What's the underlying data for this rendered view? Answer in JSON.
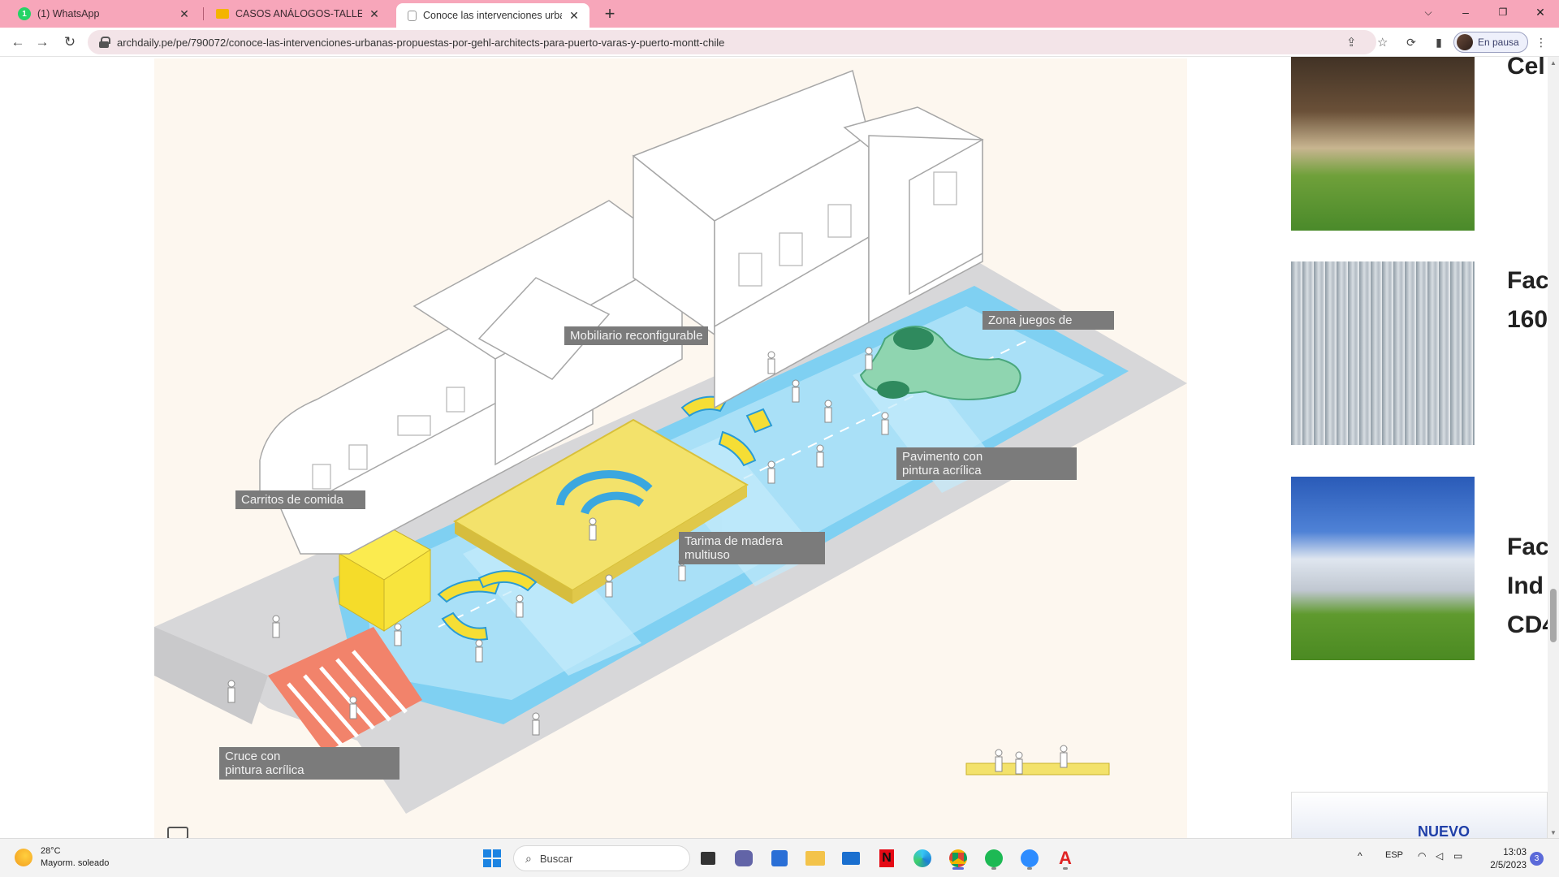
{
  "browser": {
    "tabs": [
      {
        "title": "(1) WhatsApp",
        "favicon": "whatsapp-icon",
        "color": "#25d366",
        "badge": "1"
      },
      {
        "title": "CASOS ANÁLOGOS-TALLER PRE",
        "favicon": "slides-icon",
        "color": "#f4b400"
      },
      {
        "title": "Conoce las intervenciones urban",
        "favicon": "archdaily-icon",
        "color": "#999999",
        "active": true
      }
    ],
    "url": "archdaily.pe/pe/790072/conoce-las-intervenciones-urbanas-propuestas-por-gehl-architects-para-puerto-varas-y-puerto-montt-chile",
    "profile_label": "En pausa"
  },
  "figure": {
    "labels": {
      "mobiliario": "Mobiliario reconfigurable",
      "zona_juegos": "Zona juegos de",
      "pavimento": "Pavimento con\npintura acrílica",
      "carritos": "Carritos de comida",
      "tarima": "Tarima de madera\nmultiuso",
      "cruce": "Cruce con\npintura acrílica"
    }
  },
  "sidebar": {
    "items": [
      {
        "title": "Cel"
      },
      {
        "title": "Fac\n160"
      },
      {
        "title": "Fac\nInd\nCD4"
      },
      {
        "title": "NUEVO"
      }
    ]
  },
  "taskbar": {
    "weather_temp": "28°C",
    "weather_desc": "Mayorm. soleado",
    "search_placeholder": "Buscar",
    "lang": "ESP",
    "time": "13:03",
    "date": "2/5/2023",
    "notifications": "3"
  }
}
